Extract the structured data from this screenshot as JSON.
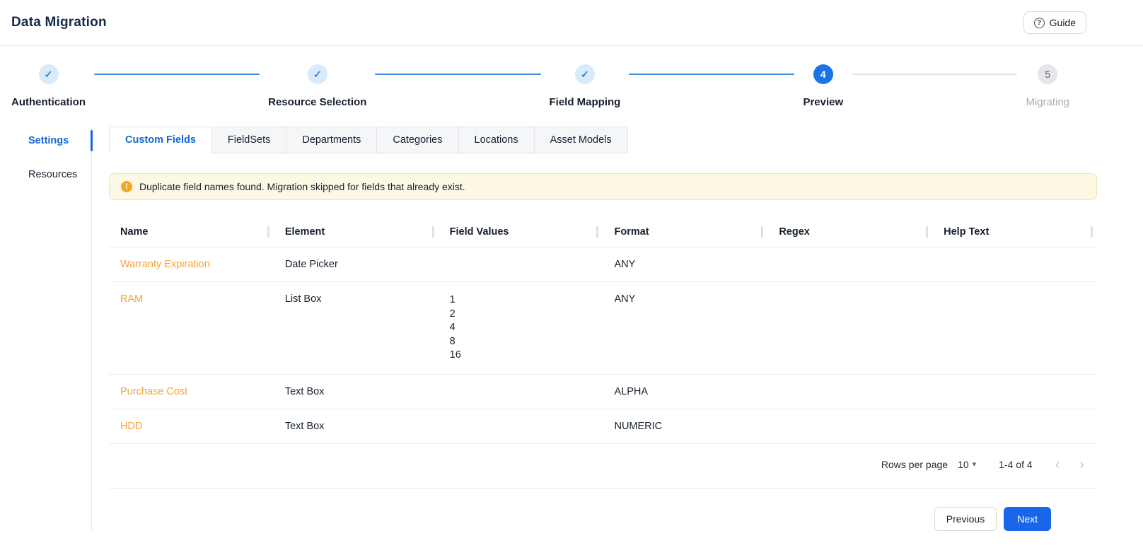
{
  "header": {
    "title": "Data Migration",
    "guide_label": "Guide"
  },
  "icons": {
    "help": "?",
    "warning": "!",
    "caret_down": "▾",
    "chevron_left": "‹",
    "chevron_right": "›"
  },
  "colors": {
    "accent_blue": "#1766d9",
    "step_active_blue": "#1a73e8",
    "step_done_bg": "#d9eafb",
    "link_orange": "#f2a33c",
    "warning_bg": "#fdf8e4",
    "warning_border": "#f0e3ab",
    "warning_icon": "#f5a623"
  },
  "stepper": {
    "steps": [
      {
        "label": "Authentication",
        "marker": "✓",
        "state": "completed"
      },
      {
        "label": "Resource Selection",
        "marker": "✓",
        "state": "completed"
      },
      {
        "label": "Field Mapping",
        "marker": "✓",
        "state": "completed"
      },
      {
        "label": "Preview",
        "marker": "4",
        "state": "active"
      },
      {
        "label": "Migrating",
        "marker": "5",
        "state": "upcoming"
      }
    ]
  },
  "sidebar": {
    "items": [
      {
        "label": "Settings",
        "active": true
      },
      {
        "label": "Resources",
        "active": false
      }
    ]
  },
  "tabs": [
    "Custom Fields",
    "FieldSets",
    "Departments",
    "Categories",
    "Locations",
    "Asset Models"
  ],
  "banner": {
    "text": "Duplicate field names found. Migration skipped for fields that already exist."
  },
  "table": {
    "columns": [
      "Name",
      "Element",
      "Field Values",
      "Format",
      "Regex",
      "Help Text"
    ],
    "rows": [
      {
        "name": "Warranty Expiration",
        "element": "Date Picker",
        "field_values": "",
        "format": "ANY",
        "regex": "",
        "help_text": ""
      },
      {
        "name": "RAM",
        "element": "List Box",
        "field_values": "1\n2\n4\n8\n16",
        "format": "ANY",
        "regex": "",
        "help_text": ""
      },
      {
        "name": "Purchase Cost",
        "element": "Text Box",
        "field_values": "",
        "format": "ALPHA",
        "regex": "",
        "help_text": ""
      },
      {
        "name": "HDD",
        "element": "Text Box",
        "field_values": "",
        "format": "NUMERIC",
        "regex": "",
        "help_text": ""
      }
    ]
  },
  "pagination": {
    "rows_per_page_label": "Rows per page",
    "rows_per_page_value": "10",
    "range": "1-4 of 4"
  },
  "footer": {
    "previous_label": "Previous",
    "next_label": "Next"
  }
}
